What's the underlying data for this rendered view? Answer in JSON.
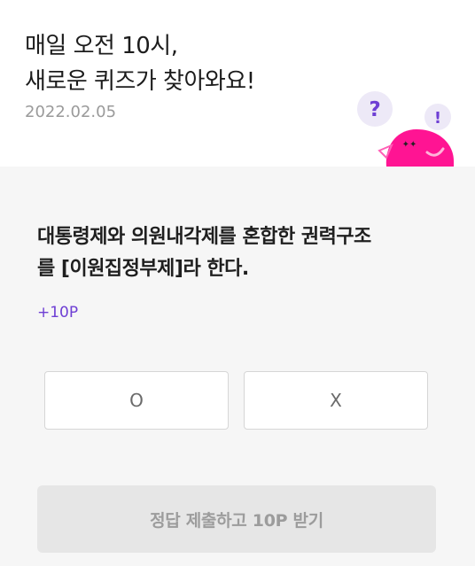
{
  "header": {
    "headline_line1": "매일 오전 10시,",
    "headline_line2": "새로운 퀴즈가 찾아와요!",
    "date": "2022.02.05",
    "mascot_icon": "pink-blob-mascot-icon",
    "mascot_question_mark": "?",
    "mascot_exclamation_mark": "!"
  },
  "quiz": {
    "question_line1": "대통령제와 의원내각제를 혼합한 권력구조",
    "question_line2": "를 [이원집정부제]라 한다.",
    "points": "+10P",
    "answer_o_label": "O",
    "answer_x_label": "X",
    "submit_label": "정답 제출하고 10P 받기"
  },
  "colors": {
    "accent_purple": "#6e3fd4",
    "mascot_pink": "#ff1493",
    "card_background": "#f6f6f6",
    "submit_disabled_bg": "#e6e6e6"
  }
}
